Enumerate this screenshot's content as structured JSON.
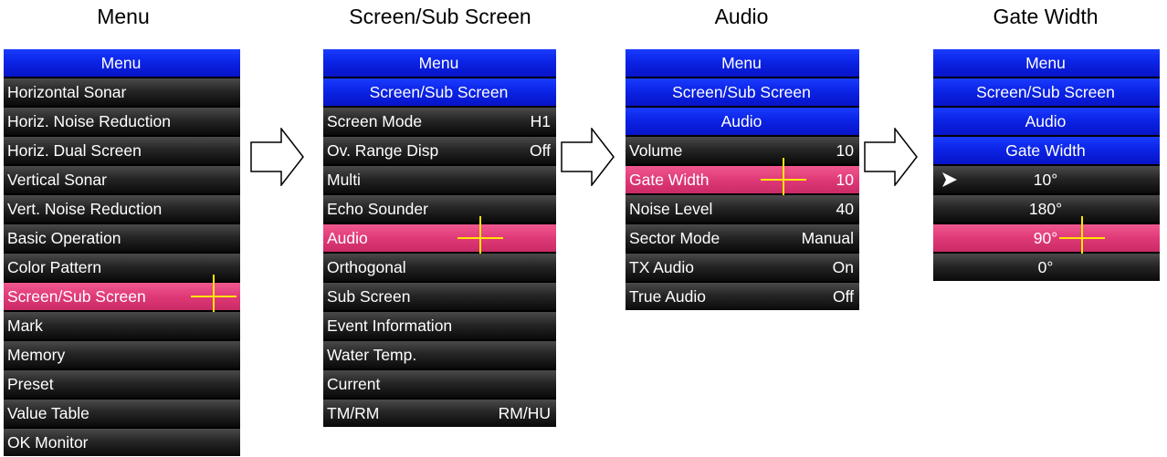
{
  "captions": [
    "Menu",
    "Screen/Sub Screen",
    "Audio",
    "Gate Width"
  ],
  "panels": [
    {
      "headers": [
        "Menu"
      ],
      "items": [
        {
          "label": "Horizontal Sonar",
          "value": ""
        },
        {
          "label": "Horiz. Noise Reduction",
          "value": ""
        },
        {
          "label": "Horiz. Dual Screen",
          "value": ""
        },
        {
          "label": "Vertical Sonar",
          "value": ""
        },
        {
          "label": "Vert. Noise Reduction",
          "value": ""
        },
        {
          "label": "Basic Operation",
          "value": ""
        },
        {
          "label": "Color Pattern",
          "value": ""
        },
        {
          "label": "Screen/Sub Screen",
          "value": "",
          "selected": true
        },
        {
          "label": "Mark",
          "value": ""
        },
        {
          "label": "Memory",
          "value": ""
        },
        {
          "label": "Preset",
          "value": ""
        },
        {
          "label": "Value Table",
          "value": ""
        },
        {
          "label": "OK Monitor",
          "value": ""
        }
      ]
    },
    {
      "headers": [
        "Menu",
        "Screen/Sub Screen"
      ],
      "items": [
        {
          "label": "Screen Mode",
          "value": "H1"
        },
        {
          "label": "Ov. Range Disp",
          "value": "Off"
        },
        {
          "label": "Multi",
          "value": ""
        },
        {
          "label": "Echo Sounder",
          "value": ""
        },
        {
          "label": "Audio",
          "value": "",
          "selected": true
        },
        {
          "label": "Orthogonal",
          "value": ""
        },
        {
          "label": "Sub Screen",
          "value": ""
        },
        {
          "label": "Event Information",
          "value": ""
        },
        {
          "label": "Water Temp.",
          "value": ""
        },
        {
          "label": "Current",
          "value": ""
        },
        {
          "label": "TM/RM",
          "value": "RM/HU"
        }
      ]
    },
    {
      "headers": [
        "Menu",
        "Screen/Sub Screen",
        "Audio"
      ],
      "items": [
        {
          "label": "Volume",
          "value": "10"
        },
        {
          "label": "Gate Width",
          "value": "10",
          "selected": true
        },
        {
          "label": "Noise Level",
          "value": "40"
        },
        {
          "label": "Sector Mode",
          "value": "Manual"
        },
        {
          "label": "TX Audio",
          "value": "On"
        },
        {
          "label": "True Audio",
          "value": "Off"
        }
      ]
    },
    {
      "headers": [
        "Menu",
        "Screen/Sub Screen",
        "Audio",
        "Gate Width"
      ],
      "options": [
        {
          "label": "10°",
          "current": true
        },
        {
          "label": "180°"
        },
        {
          "label": "90°",
          "selected": true
        },
        {
          "label": "0°"
        }
      ]
    }
  ],
  "icons": {
    "flow_arrow": "right-arrow-outline-icon",
    "current_marker": "triangle-pointer-icon",
    "cursor": "crosshair-cursor-icon"
  },
  "colors": {
    "header_blue": "#0b24e6",
    "selected_pink": "#df3a78",
    "cursor_yellow": "#ffe600",
    "row_dark": "#1a1a1a"
  }
}
